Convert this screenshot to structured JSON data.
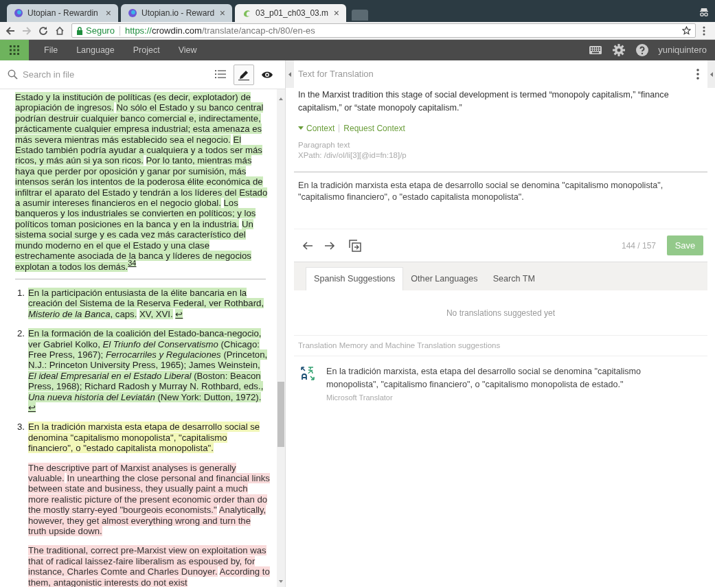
{
  "browser": {
    "tabs": [
      {
        "title": "Utopian - Rewardin",
        "close": "×",
        "selected": false,
        "kind": "utopian"
      },
      {
        "title": "Utopian.io - Reward",
        "close": "×",
        "selected": false,
        "kind": "utopian"
      },
      {
        "title": "03_p01_ch03_03.m",
        "close": "×",
        "selected": true,
        "kind": "crowdin"
      }
    ],
    "security": "Seguro",
    "url_scheme": "https://",
    "url_host": "crowdin.com",
    "url_path": "/translate/ancap-ch/80/en-es"
  },
  "menu": {
    "items": [
      "File",
      "Language",
      "Project",
      "View"
    ],
    "user": "yuniquintero"
  },
  "file_panel": {
    "search_placeholder": "Search in file",
    "view_modes": [
      {
        "kind": "list",
        "selected": false
      },
      {
        "kind": "edit",
        "selected": true
      },
      {
        "kind": "preview",
        "selected": false
      }
    ],
    "paragraphs": [
      {
        "segments": [
          {
            "text": "Estado y la institución de políticas (es decir, explotador) de apropiación de ingresos.",
            "kind": "translated"
          },
          {
            "text": "No sólo el Estado y su banco central podrían destruir cualquier banco comercial e, indirectamente, prácticamente cualquier empresa industrial; esta amenaza es más severa mientras más establecido sea el negocio.",
            "kind": "translated"
          },
          {
            "text": "El Estado también podría ayudar a cualquiera y a todos ser más ricos, y más aún si ya son ricos.",
            "kind": "translated"
          },
          {
            "text": "Por lo tanto, mientras más haya que perder por oposición y ganar por sumisión, más intensos serán los intentos de la poderosa élite económica de infiltrar el aparato del Estado y tendrán a los líderes del Estado a asumir intereses financieros en el negocio global.",
            "kind": "translated"
          },
          {
            "text": "Los banqueros y los industriales se convierten en políticos; y los políticos toman posiciones en la banca y en la industria.",
            "kind": "translated"
          },
          {
            "text": "Un sistema social surge y es cada vez más característico del mundo moderno en el que el Estado y una clase estrechamente asociada de la banca y líderes de negocios explotan a todos los demás.",
            "kind": "translated"
          }
        ],
        "footnote_ref": "34"
      }
    ],
    "notes": [
      {
        "number": "1.",
        "paragraphs": [
          {
            "segments": [
              {
                "text": "En la participación entusiasta de la élite bancaria en la creación del Sistema de la Reserva Federal, ver Rothbard, *Misterio de la Banca*, caps.",
                "kind": "translated"
              },
              {
                "text": "XV, XVI.",
                "kind": "translated"
              }
            ],
            "backlink": "↩"
          }
        ]
      },
      {
        "number": "2.",
        "paragraphs": [
          {
            "segments": [
              {
                "text": "En la formación de la coalición del Estado-banca-negocio, ver Gabriel Kolko, *El Triunfo del Conservatismo* (Chicago: Free Press, 1967); *Ferrocarriles y Regulaciones* (Princeton, N.J.: Princeton University Press, 1965); James Weinstein, *El ideal Empresarial en el Estado Liberal* (Boston: Beacon Press, 1968); Richard Radosh y Murray N. Rothbard, eds., *Una nueva historia del Leviatán* (New York: Dutton, 1972).",
                "kind": "translated"
              }
            ],
            "backlink": "↩"
          }
        ]
      },
      {
        "number": "3.",
        "paragraphs": [
          {
            "segments": [
              {
                "text": "En la tradición marxista esta etapa de desarrollo social se denomina \"capitalismo monopolista\", \"capitalismo financiero\", o \"estado capitalista monopolista\".",
                "kind": "current"
              }
            ]
          },
          {
            "segments": [
              {
                "text": "The descriptive part of Marxist analyses is generally valuable.",
                "kind": "untranslated"
              },
              {
                "text": "In unearthing the close personal and financial links between state and business, they usually paint a much more realistic picture of the present economic order than do the mostly starry-eyed \"bourgeois economists.\"",
                "kind": "untranslated"
              },
              {
                "text": "Analytically, however, they get almost everything wrong and turn the truth upside down.",
                "kind": "untranslated"
              }
            ]
          },
          {
            "segments": [
              {
                "text": "The traditional, correct pre-Marxist view on exploitation was that of radical laissez-faire liberalism as espoused by, for instance, Charles Comte and Charles Dunoyer.",
                "kind": "untranslated"
              },
              {
                "text": "According to them, antagonistic interests do not exist",
                "kind": "untranslated"
              }
            ]
          }
        ]
      }
    ]
  },
  "editor": {
    "header": "Text for Translation",
    "source": "In the Marxist tradition this stage of social development is termed “monopoly capitalism,” “finance capitalism,” or “state monopoly capitalism.”",
    "context_toggle": "Context",
    "context_expanded": true,
    "request_context": "Request Context",
    "context_lines": [
      "Paragraph text",
      "XPath: /div/ol/li[3][@id=fn:18]/p"
    ],
    "translation": "En la tradición marxista esta etapa de desarrollo social se denomina \"capitalismo monopolista\", \"capitalismo financiero\", o \"estado capitalista monopolista\".",
    "counter": "144 / 157",
    "save": "Save"
  },
  "suggestions": {
    "tabs": [
      {
        "label": "Spanish Suggestions",
        "selected": true
      },
      {
        "label": "Other Languages",
        "selected": false
      },
      {
        "label": "Search TM",
        "selected": false
      }
    ],
    "empty": "No translations suggested yet",
    "mt_header": "Translation Memory and Machine Translation suggestions",
    "mt_items": [
      {
        "text": "En la tradición marxista, esta etapa del desarrollo social se denomina \"capitalismo monopolista\", \"capitalismo financiero\", o \"capitalismo monopolista de estado.\"",
        "source": "Microsoft Translator"
      }
    ]
  }
}
